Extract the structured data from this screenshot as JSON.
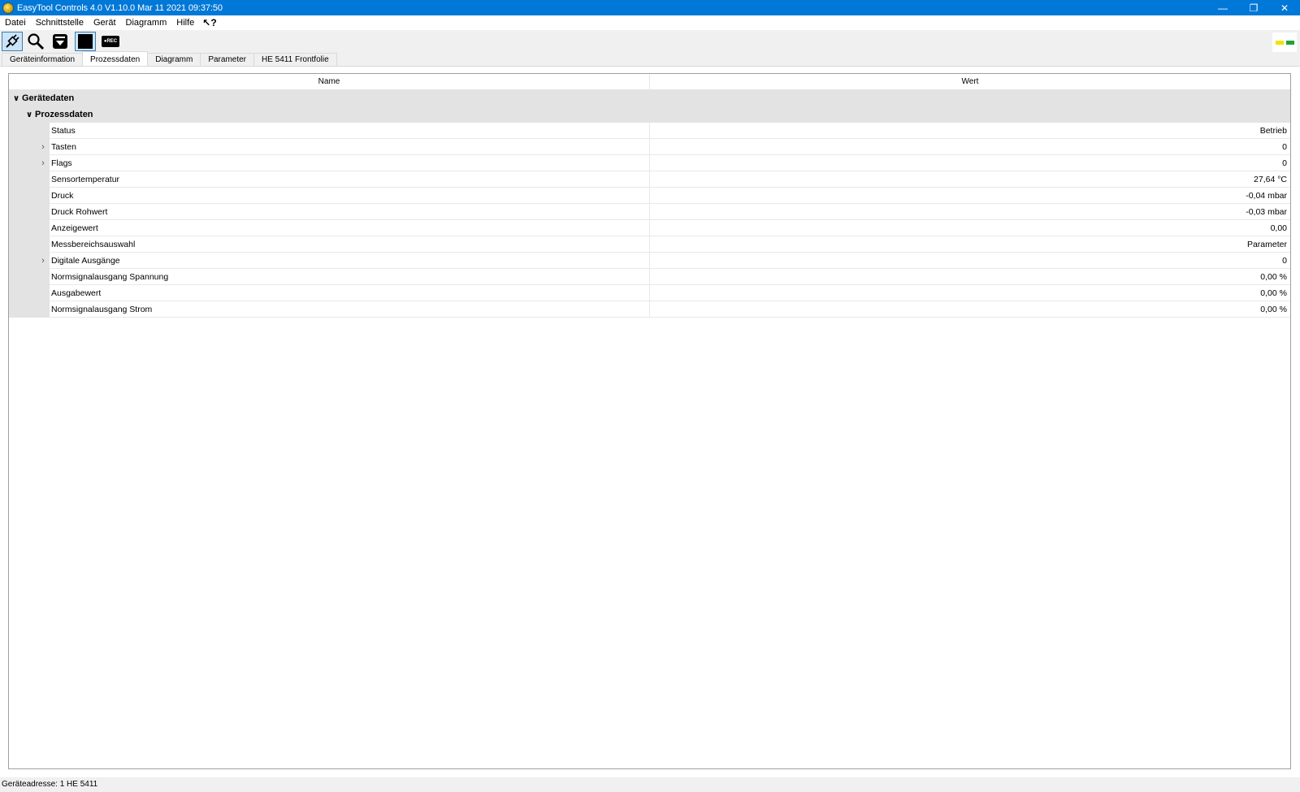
{
  "window": {
    "title": "EasyTool Controls 4.0 V1.10.0 Mar 11 2021 09:37:50",
    "minimize": "—",
    "restore": "❐",
    "close": "✕"
  },
  "menu": {
    "items": [
      "Datei",
      "Schnittstelle",
      "Gerät",
      "Diagramm",
      "Hilfe"
    ],
    "help_icon": "↖?"
  },
  "toolbar": {
    "rec_label": "●REC",
    "led_colors": [
      "#f2e200",
      "#1ea339"
    ]
  },
  "tabs": [
    {
      "label": "Geräteinformation",
      "selected": false
    },
    {
      "label": "Prozessdaten",
      "selected": true
    },
    {
      "label": "Diagramm",
      "selected": false
    },
    {
      "label": "Parameter",
      "selected": false
    },
    {
      "label": "HE 5411 Frontfolie",
      "selected": false
    }
  ],
  "grid": {
    "col_name": "Name",
    "col_wert": "Wert",
    "category1": "Gerätedaten",
    "category2": "Prozessdaten",
    "rows": [
      {
        "name": "Status",
        "value": "Betrieb",
        "expandable": false
      },
      {
        "name": "Tasten",
        "value": "0",
        "expandable": true
      },
      {
        "name": "Flags",
        "value": "0",
        "expandable": true
      },
      {
        "name": "Sensortemperatur",
        "value": "27,64 °C",
        "expandable": false
      },
      {
        "name": "Druck",
        "value": "-0,04 mbar",
        "expandable": false
      },
      {
        "name": "Druck Rohwert",
        "value": "-0,03 mbar",
        "expandable": false
      },
      {
        "name": "Anzeigewert",
        "value": "0,00",
        "expandable": false
      },
      {
        "name": "Messbereichsauswahl",
        "value": "Parameter",
        "expandable": false
      },
      {
        "name": "Digitale Ausgänge",
        "value": "0",
        "expandable": true
      },
      {
        "name": "Normsignalausgang Spannung",
        "value": "0,00 %",
        "expandable": false
      },
      {
        "name": "Ausgabewert",
        "value": "0,00 %",
        "expandable": false
      },
      {
        "name": "Normsignalausgang Strom",
        "value": "0,00 %",
        "expandable": false
      }
    ]
  },
  "statusbar": {
    "text": "Geräteadresse: 1  HE 5411"
  }
}
